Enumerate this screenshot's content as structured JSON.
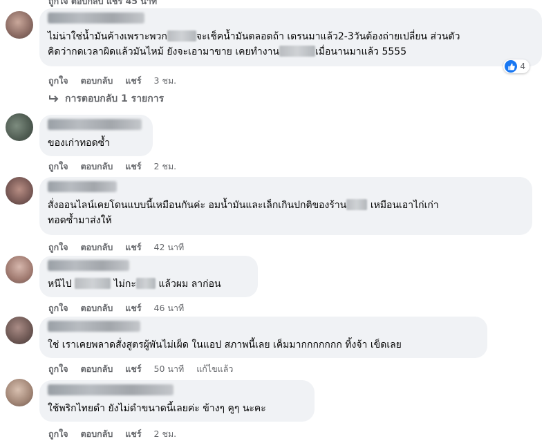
{
  "actions": {
    "like": "ถูกใจ",
    "reply": "ตอบกลับ",
    "share": "แชร์"
  },
  "top_partial": "ถูกใจ   ตอบกลับ   แชร์   45 นาที",
  "comments": [
    {
      "text_lines": [
        "ไม่น่าใช่น้ำมันค้างเพราะพวก",
        "จะเช็คน้ำมันตลอดถ้า เดรนมาแล้ว2-3วันต้องถ่ายเปลี่ยน ส่วนตัว",
        "คิดว่ากดเวลาผิดแล้วมันไหม้ ยังจะเอามาขาย เคยทำงาน",
        "เมื่อนานมาแล้ว 5555"
      ],
      "time": "3 ชม.",
      "reaction_count": "4",
      "replies_label": "การตอบกลับ 1 รายการ"
    },
    {
      "text": "ของเก่าทอดซ้ำ",
      "time": "2 ชม."
    },
    {
      "line1a": "สั่งออนไลน์เคยโดนแบบนี้เหมือนกันค่ะ อมน้ำมันและเล็กเกินปกติของร้าน",
      "line1b": "เหมือนเอาไก่เก่า",
      "line2": "ทอดซ้ำมาส่งให้",
      "time": "42 นาที"
    },
    {
      "part1": "หนีไป",
      "part2": "ไม่กะ",
      "part3": "แล้วผม ลาก่อน",
      "time": "46 นาที"
    },
    {
      "text": "ใช่ เราเคยพลาดสั่งสูตรผู้พันไม่เผ็ด ในแอป สภาพนี้เลย เค็มมากกกกกกก ทิ้งจ้า เข็ดเลย",
      "time": "50 นาที",
      "edited": "แก้ไขแล้ว"
    },
    {
      "text": "ใช้พริกไทยดำ ยังไม่ดำขนาดนี้เลยค่ะ ข้างๆ คูๆ นะคะ",
      "time": "2 ชม."
    }
  ]
}
